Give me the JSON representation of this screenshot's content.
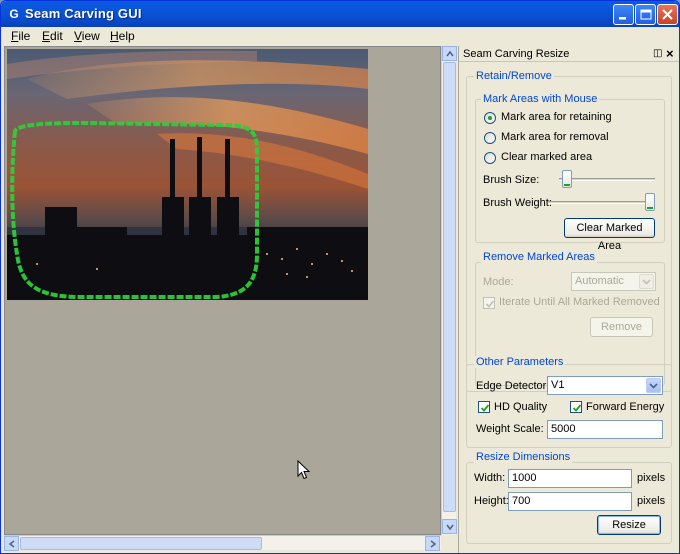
{
  "window": {
    "title": "Seam Carving GUI",
    "icon_glyph": "G"
  },
  "menu": [
    "File",
    "Edit",
    "View",
    "Help"
  ],
  "panel": {
    "title": "Seam Carving Resize",
    "retain_remove": {
      "legend": "Retain/Remove",
      "mark_areas": {
        "legend": "Mark Areas with Mouse",
        "options": [
          "Mark area for retaining",
          "Mark area for removal",
          "Clear marked area"
        ],
        "selected_index": 0,
        "brush_size_label": "Brush Size:",
        "brush_size_value": 0.03,
        "brush_weight_label": "Brush Weight:",
        "brush_weight_value": 1.0,
        "clear_button": "Clear Marked Area"
      },
      "remove_marked": {
        "legend": "Remove Marked Areas",
        "mode_label": "Mode:",
        "mode_value": "Automatic",
        "iterate_label": "Iterate Until All Marked Removed",
        "iterate_checked": true,
        "remove_button": "Remove"
      }
    },
    "other_params": {
      "legend": "Other Parameters",
      "edge_detector_label": "Edge Detector:",
      "edge_detector_value": "V1",
      "hd_quality_label": "HD Quality",
      "hd_quality_checked": true,
      "forward_energy_label": "Forward Energy",
      "forward_energy_checked": true,
      "weight_scale_label": "Weight Scale:",
      "weight_scale_value": "5000"
    },
    "resize_dims": {
      "legend": "Resize Dimensions",
      "width_label": "Width:",
      "width_value": "1000",
      "height_label": "Height:",
      "height_value": "700",
      "unit": "pixels",
      "resize_button": "Resize"
    }
  },
  "colors": {
    "title_bar": "#0a5ae6",
    "selection_stroke": "#2ecc3a",
    "legend_text": "#0046d5",
    "canvas_bg": "#aaa69a"
  }
}
